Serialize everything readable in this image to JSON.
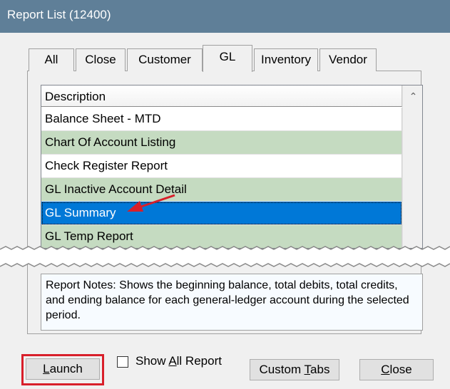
{
  "window": {
    "title": "Report List (12400)"
  },
  "tabs": [
    {
      "label": "All"
    },
    {
      "label": "Close"
    },
    {
      "label": "Customer"
    },
    {
      "label": "GL"
    },
    {
      "label": "Inventory"
    },
    {
      "label": "Vendor"
    }
  ],
  "active_tab": "GL",
  "list": {
    "column_header": "Description",
    "rows": [
      {
        "description": "Balance Sheet - MTD"
      },
      {
        "description": "Chart Of Account Listing"
      },
      {
        "description": "Check Register Report"
      },
      {
        "description": "GL Inactive Account Detail"
      },
      {
        "description": "GL Summary"
      },
      {
        "description": "GL Temp Report"
      }
    ],
    "selected": "GL Summary"
  },
  "notes": {
    "text": "Report Notes:  Shows the beginning balance, total debits, total credits, and ending balance for each general-ledger account during the selected period."
  },
  "buttons": {
    "launch": {
      "pre": "",
      "ul": "L",
      "post": "aunch"
    },
    "custom_tabs": {
      "pre": "Custom ",
      "ul": "T",
      "post": "abs"
    },
    "close": {
      "pre": "",
      "ul": "C",
      "post": "lose"
    }
  },
  "checkbox": {
    "pre": "Show ",
    "ul": "A",
    "post": "ll Report",
    "checked": false
  },
  "colors": {
    "titlebar": "#5f7f98",
    "selected_row": "#0078d7",
    "alt_row": "#c5dbc1",
    "annotation": "#d81f2a"
  }
}
